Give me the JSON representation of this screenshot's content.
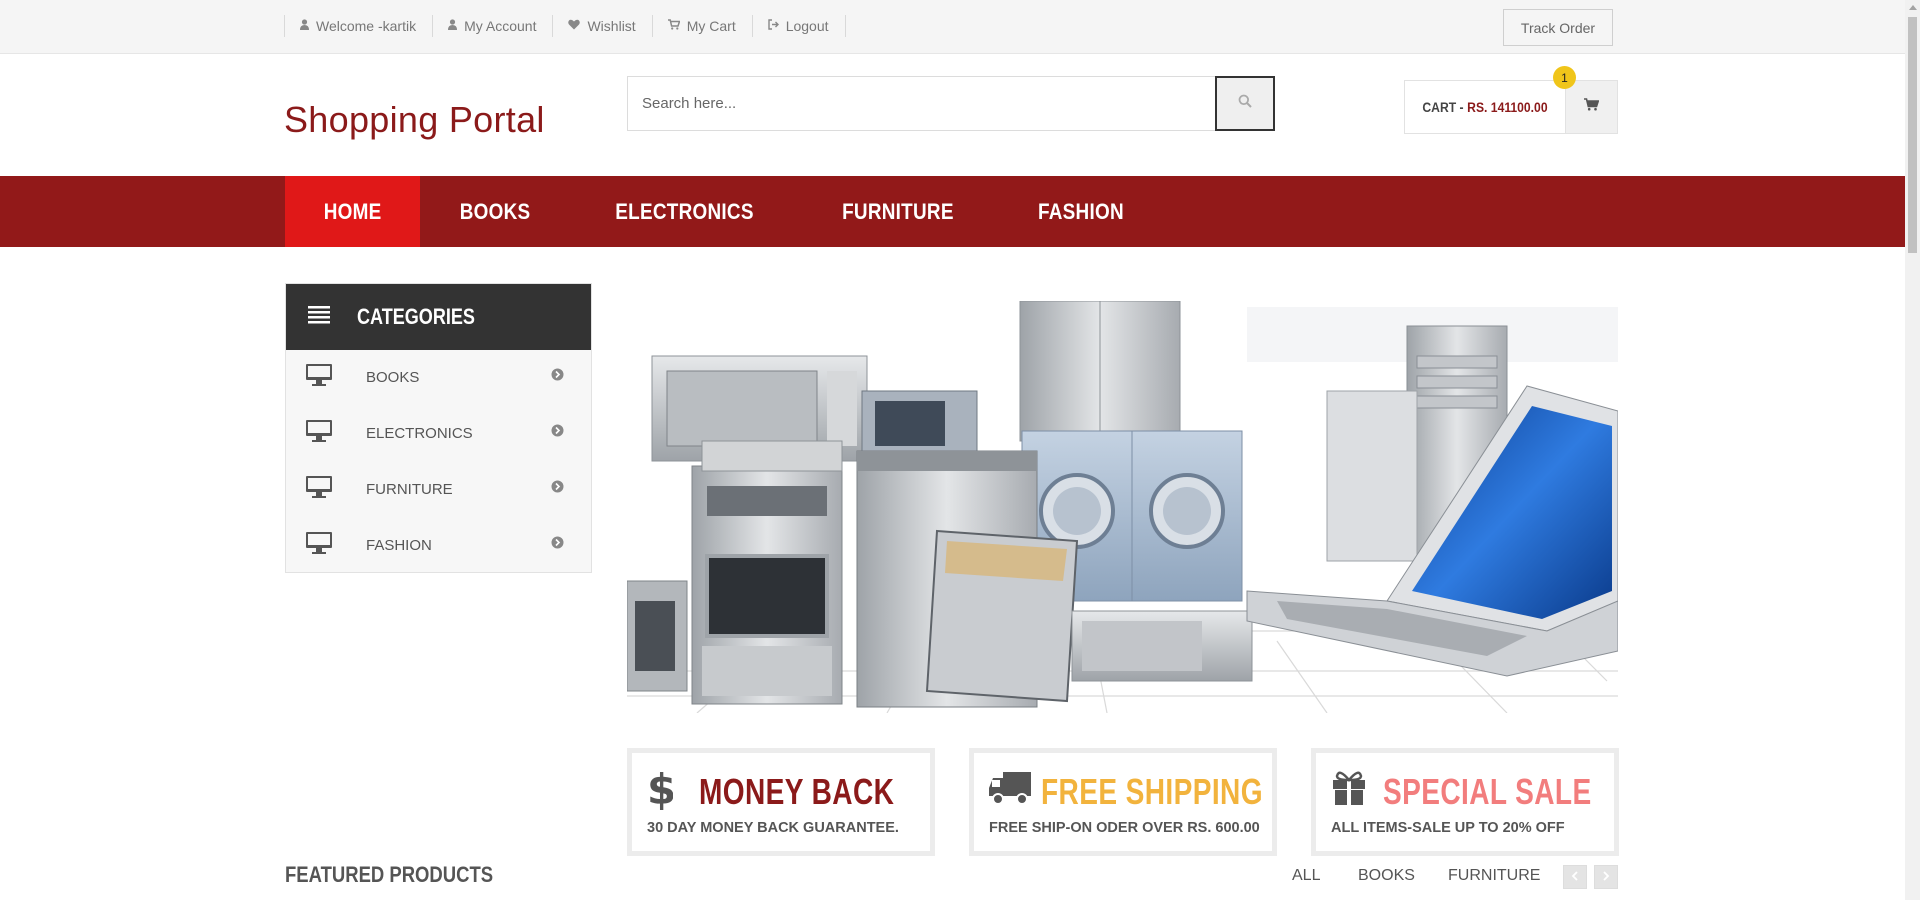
{
  "topbar": {
    "links": [
      {
        "label": "Welcome -kartik",
        "icon": "user-icon"
      },
      {
        "label": "My Account",
        "icon": "user-icon"
      },
      {
        "label": "Wishlist",
        "icon": "heart-icon"
      },
      {
        "label": "My Cart",
        "icon": "cart-icon"
      },
      {
        "label": "Logout",
        "icon": "sign-out-icon"
      }
    ],
    "track_order": "Track Order"
  },
  "header": {
    "logo": "Shopping Portal",
    "search_placeholder": "Search here...",
    "search_value": "",
    "cart_label": "CART -",
    "cart_amount": "RS. 141100.00",
    "cart_count": "1"
  },
  "nav": {
    "items": [
      "HOME",
      "BOOKS",
      "ELECTRONICS",
      "FURNITURE",
      "FASHION"
    ],
    "active": "HOME"
  },
  "categories": {
    "title": "CATEGORIES",
    "items": [
      "BOOKS",
      "ELECTRONICS",
      "FURNITURE",
      "FASHION"
    ]
  },
  "info_boxes": [
    {
      "title": "MONEY BACK",
      "subtitle": "30 DAY MONEY BACK GUARANTEE.",
      "icon": "dollar-icon",
      "color": "#8b1a1a"
    },
    {
      "title": "FREE SHIPPING",
      "subtitle": "FREE SHIP-ON ODER OVER RS. 600.00",
      "icon": "truck-icon",
      "color": "#f2b33d"
    },
    {
      "title": "SPECIAL SALE",
      "subtitle": "ALL ITEMS-SALE UP TO 20% OFF",
      "icon": "gift-icon",
      "color": "#f27d7d"
    }
  ],
  "featured": {
    "title": "FEATURED PRODUCTS",
    "tabs": [
      "ALL",
      "BOOKS",
      "FURNITURE"
    ]
  },
  "colors": {
    "brand": "#8b1a1a",
    "nav_bg": "#921919",
    "nav_active": "#e01818",
    "badge": "#f0c51a"
  }
}
